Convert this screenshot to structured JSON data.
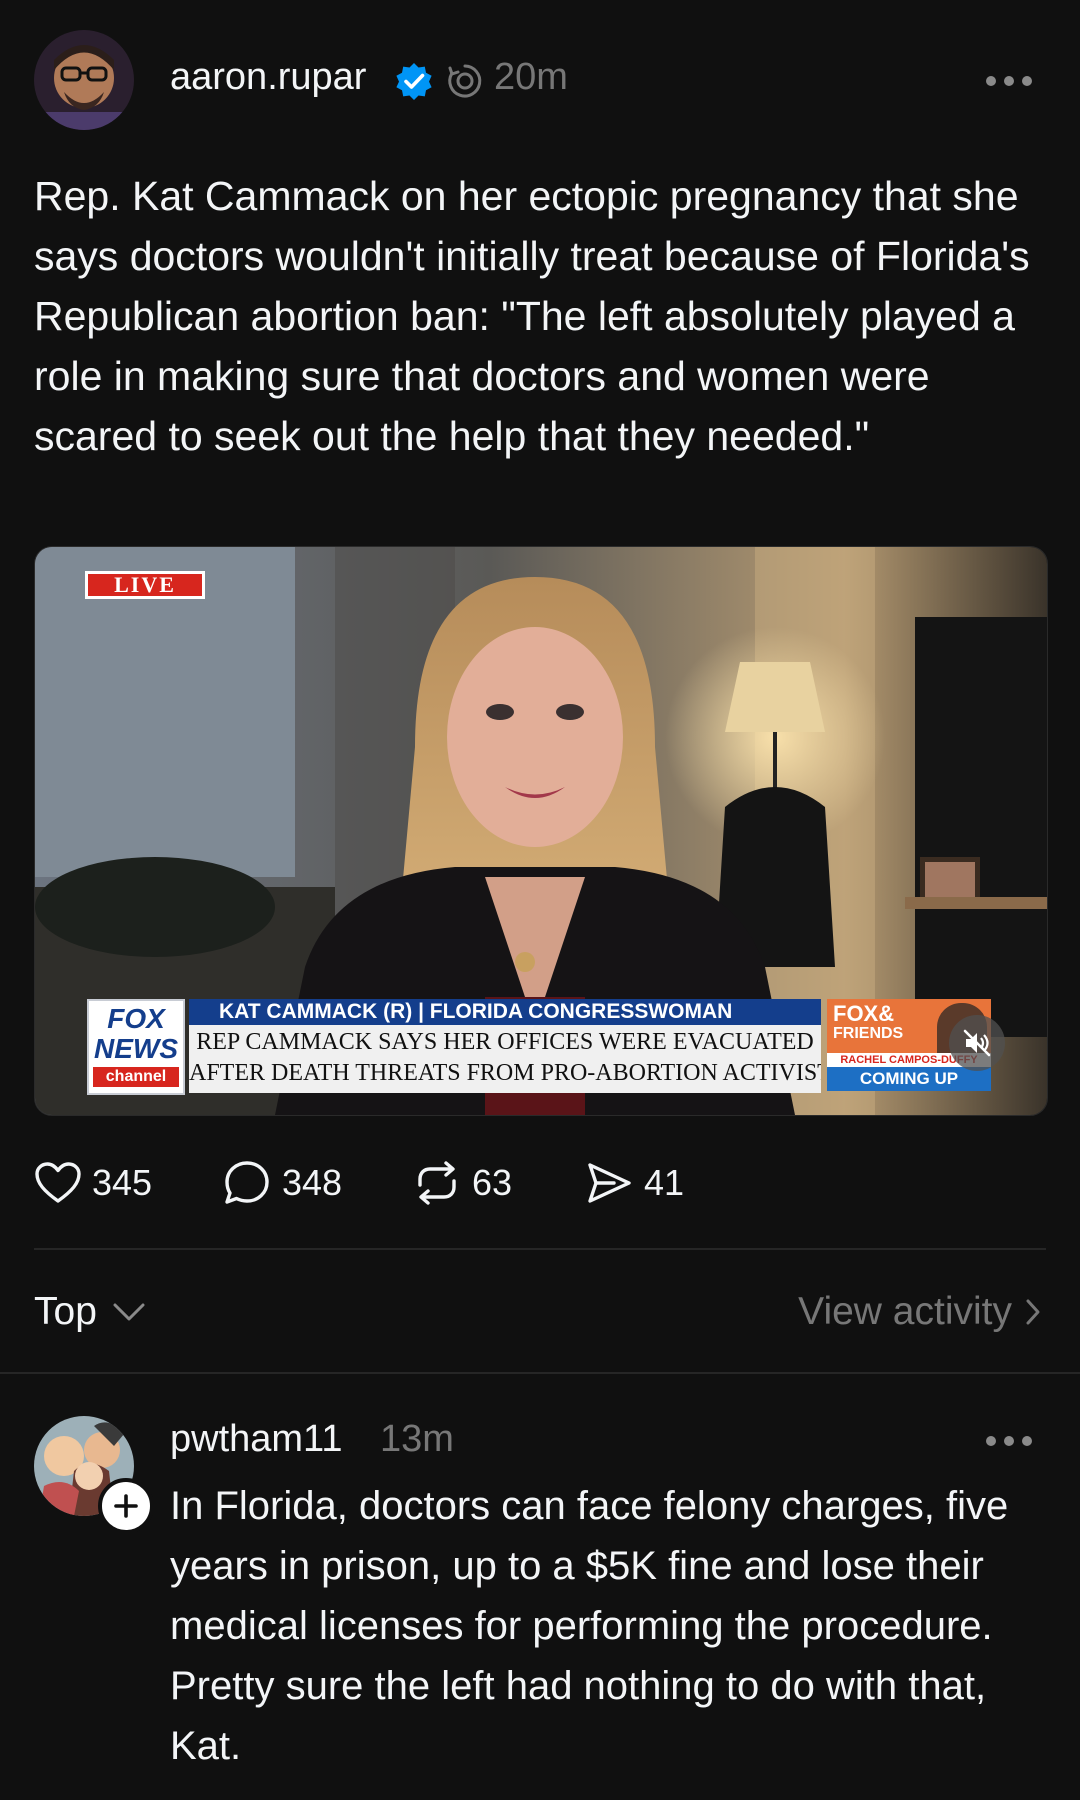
{
  "post": {
    "username": "aaron.rupar",
    "time": "20m",
    "text": "Rep. Kat Cammack on her ectopic pregnancy that she says doctors wouldn't initially treat because of Florida's Republican abortion ban: \"The left absolutely played a role in making sure that doctors and women were scared to seek out the help that they needed.\"",
    "video": {
      "live_label": "LIVE",
      "network_logo": [
        "FOX",
        "NEWS",
        "channel"
      ],
      "chyron_name": "KAT CAMMACK (R) | FLORIDA CONGRESSWOMAN",
      "chyron_line1": "REP CAMMACK SAYS HER OFFICES WERE EVACUATED",
      "chyron_line2": "AFTER DEATH THREATS FROM PRO-ABORTION ACTIVISTS",
      "promo_title": [
        "FOX&",
        "FRIENDS"
      ],
      "promo_name": "RACHEL CAMPOS-DUFFY",
      "promo_coming": "COMING UP"
    },
    "actions": {
      "likes": "345",
      "comments": "348",
      "reposts": "63",
      "shares": "41"
    }
  },
  "sort": {
    "label": "Top",
    "view_activity": "View activity"
  },
  "reply": {
    "username": "pwtham11",
    "time": "13m",
    "text": "In Florida, doctors can face felony charges, five years in prison, up to a $5K fine and lose their medical licenses for performing the procedure. Pretty sure the left had nothing to do with that, Kat."
  },
  "colors": {
    "background": "#101010",
    "text": "#f3f5f7",
    "muted": "#777777",
    "verified": "#0095f6",
    "live_red": "#d7261e",
    "fox_blue": "#143e8c"
  }
}
